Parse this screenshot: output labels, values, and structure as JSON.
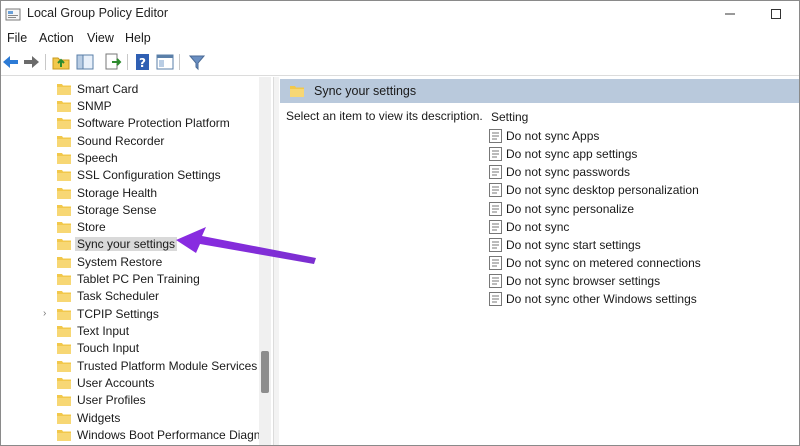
{
  "window": {
    "title": "Local Group Policy Editor"
  },
  "menu": [
    "File",
    "Action",
    "View",
    "Help"
  ],
  "tree": {
    "items": [
      {
        "label": "Smart Card"
      },
      {
        "label": "SNMP"
      },
      {
        "label": "Software Protection Platform"
      },
      {
        "label": "Sound Recorder"
      },
      {
        "label": "Speech"
      },
      {
        "label": "SSL Configuration Settings"
      },
      {
        "label": "Storage Health"
      },
      {
        "label": "Storage Sense"
      },
      {
        "label": "Store"
      },
      {
        "label": "Sync your settings",
        "selected": true
      },
      {
        "label": "System Restore"
      },
      {
        "label": "Tablet PC Pen Training"
      },
      {
        "label": "Task Scheduler"
      },
      {
        "label": "TCPIP Settings",
        "expandable": true
      },
      {
        "label": "Text Input"
      },
      {
        "label": "Touch Input"
      },
      {
        "label": "Trusted Platform Module Services"
      },
      {
        "label": "User Accounts"
      },
      {
        "label": "User Profiles"
      },
      {
        "label": "Widgets"
      },
      {
        "label": "Windows Boot Performance Diagnos"
      }
    ]
  },
  "right": {
    "header_title": "Sync your settings",
    "description": "Select an item to view its description.",
    "column_header": "Setting",
    "settings": [
      "Do not sync Apps",
      "Do not sync app settings",
      "Do not sync passwords",
      "Do not sync desktop personalization",
      "Do not sync personalize",
      "Do not sync",
      "Do not sync start settings",
      "Do not sync on metered connections",
      "Do not sync browser settings",
      "Do not sync other Windows settings"
    ]
  },
  "colors": {
    "header_bg": "#b9c9dc",
    "folder": "#f2c84b",
    "annotation_arrow": "#8a2be2",
    "selection": "#d9d9d9"
  },
  "icons": [
    "app-icon",
    "minimize-icon",
    "maximize-icon",
    "back-arrow-icon",
    "forward-arrow-icon",
    "up-folder-icon",
    "show-hide-tree-icon",
    "export-list-icon",
    "help-icon",
    "extended-view-icon",
    "filter-icon",
    "folder-icon",
    "policy-setting-icon"
  ]
}
